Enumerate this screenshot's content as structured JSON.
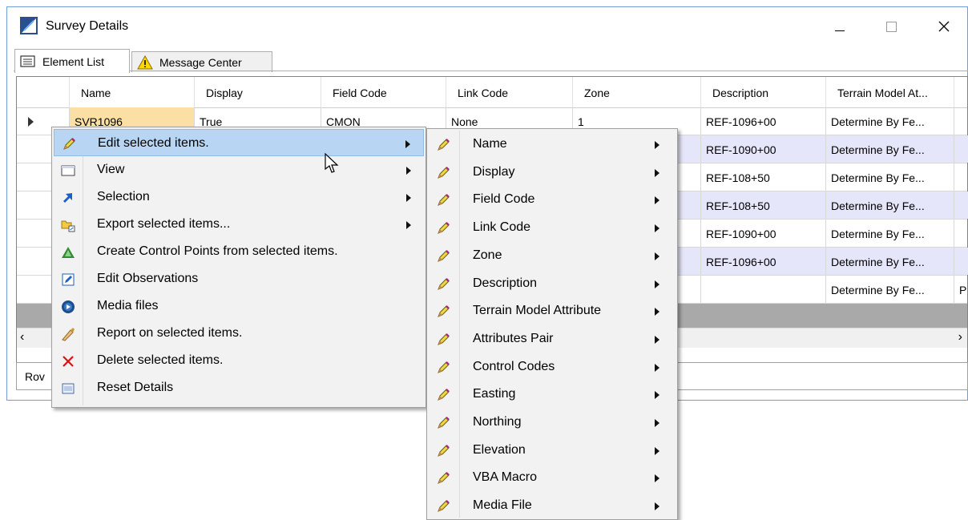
{
  "window": {
    "title": "Survey Details"
  },
  "tabs": [
    {
      "label": "Element List",
      "active": true
    },
    {
      "label": "Message Center",
      "active": false
    }
  ],
  "grid": {
    "columns": [
      "Name",
      "Display",
      "Field Code",
      "Link Code",
      "Zone",
      "Description",
      "Terrain Model At..."
    ],
    "rows": [
      {
        "name": "SVR1096",
        "display": "True",
        "field_code": "CMON",
        "link_code": "None",
        "zone": "1",
        "description": "REF-1096+00",
        "terrain": "Determine By Fe...",
        "extra": ""
      },
      {
        "name": "",
        "display": "",
        "field_code": "",
        "link_code": "",
        "zone": "",
        "description": "REF-1090+00",
        "terrain": "Determine By Fe...",
        "extra": ""
      },
      {
        "name": "",
        "display": "",
        "field_code": "",
        "link_code": "",
        "zone": "",
        "description": "REF-108+50",
        "terrain": "Determine By Fe...",
        "extra": ""
      },
      {
        "name": "",
        "display": "",
        "field_code": "",
        "link_code": "",
        "zone": "",
        "description": "REF-108+50",
        "terrain": "Determine By Fe...",
        "extra": ""
      },
      {
        "name": "",
        "display": "",
        "field_code": "",
        "link_code": "",
        "zone": "",
        "description": "REF-1090+00",
        "terrain": "Determine By Fe...",
        "extra": ""
      },
      {
        "name": "",
        "display": "",
        "field_code": "",
        "link_code": "",
        "zone": "",
        "description": "REF-1096+00",
        "terrain": "Determine By Fe...",
        "extra": ""
      },
      {
        "name": "",
        "display": "",
        "field_code": "",
        "link_code": "",
        "zone": "",
        "description": "",
        "terrain": "Determine By Fe...",
        "extra": "P"
      }
    ]
  },
  "status": {
    "text": "Rov"
  },
  "context_menu": {
    "items": [
      {
        "label": "Edit selected items.",
        "icon": "pencil-icon",
        "submenu": true,
        "highlighted": true
      },
      {
        "label": "View",
        "icon": "window-icon",
        "submenu": true
      },
      {
        "label": "Selection",
        "icon": "arrow-cursor-icon",
        "submenu": true
      },
      {
        "label": "Export selected items...",
        "icon": "export-folder-icon",
        "submenu": true
      },
      {
        "label": "Create Control Points from selected items.",
        "icon": "triangle-icon",
        "submenu": false
      },
      {
        "label": "Edit Observations",
        "icon": "edit-box-icon",
        "submenu": false
      },
      {
        "label": "Media files",
        "icon": "media-icon",
        "submenu": false
      },
      {
        "label": "Report on selected items.",
        "icon": "report-icon",
        "submenu": false
      },
      {
        "label": "Delete selected items.",
        "icon": "delete-x-icon",
        "submenu": false
      },
      {
        "label": "Reset Details",
        "icon": "reset-icon",
        "submenu": false
      }
    ]
  },
  "submenu": {
    "items": [
      "Name",
      "Display",
      "Field Code",
      "Link Code",
      "Zone",
      "Description",
      "Terrain Model Attribute",
      "Attributes Pair",
      "Control Codes",
      "Easting",
      "Northing",
      "Elevation",
      "VBA Macro",
      "Media File"
    ]
  },
  "colors": {
    "alt_row": "#e6e6fa",
    "selected_cell": "#fbe0a5",
    "menu_highlight": "#b8d6f3",
    "window_border": "#6f9fd6"
  }
}
